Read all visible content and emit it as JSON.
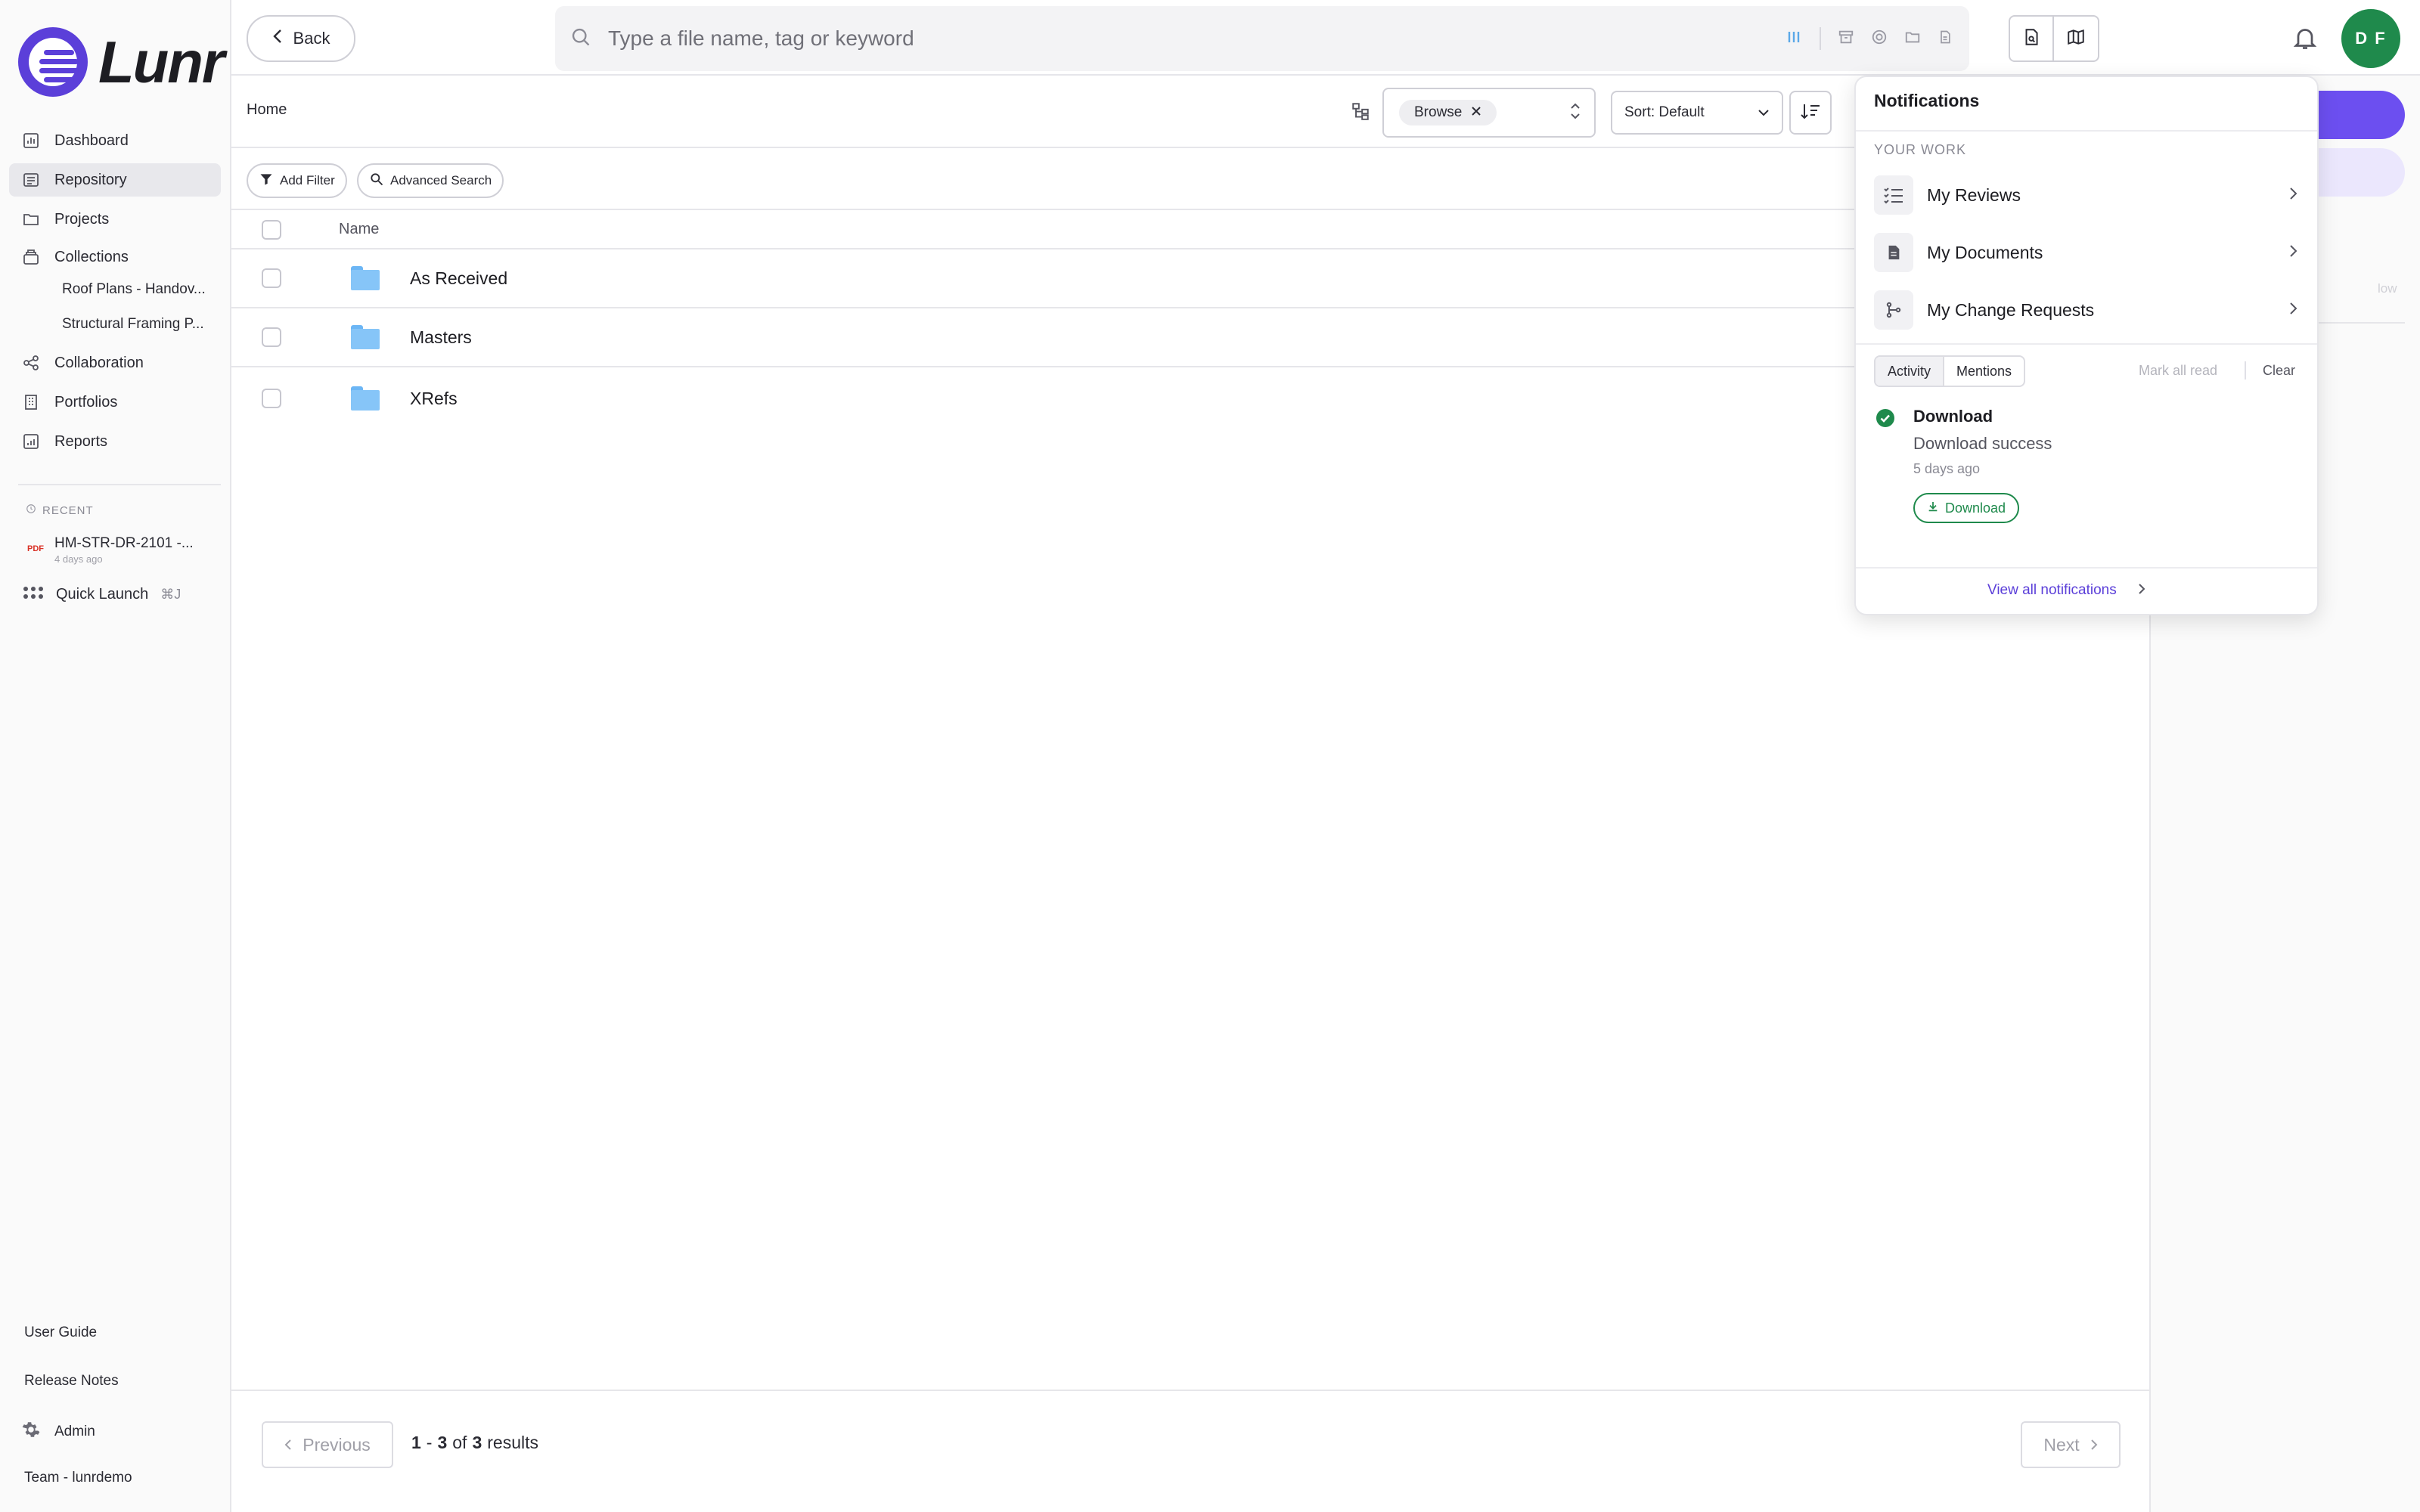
{
  "app": {
    "name": "Lunr"
  },
  "sidebar": {
    "items": [
      {
        "label": "Dashboard",
        "icon": "chart-icon"
      },
      {
        "label": "Repository",
        "icon": "repository-icon",
        "active": true
      },
      {
        "label": "Projects",
        "icon": "folder-icon"
      },
      {
        "label": "Collections",
        "icon": "collections-icon"
      },
      {
        "label": "Collaboration",
        "icon": "share-icon"
      },
      {
        "label": "Portfolios",
        "icon": "building-icon"
      },
      {
        "label": "Reports",
        "icon": "report-icon"
      }
    ],
    "collections": [
      "Roof Plans - Handov...",
      "Structural Framing P..."
    ],
    "recent_heading": "RECENT",
    "recent_item": {
      "badge": "PDF",
      "name": "HM-STR-DR-2101 -...",
      "time": "4 days ago"
    },
    "quick_launch": {
      "label": "Quick Launch",
      "shortcut": "⌘J"
    },
    "bottom": {
      "user_guide": "User Guide",
      "release_notes": "Release Notes",
      "admin": "Admin",
      "team": "Team - lunrdemo"
    }
  },
  "header": {
    "back_label": "Back",
    "search_placeholder": "Type a file name, tag or keyword",
    "avatar_initials": "D F"
  },
  "toolbar": {
    "breadcrumb": "Home",
    "browse_chip": "Browse",
    "sort_label": "Sort: Default",
    "add_filter": "Add Filter",
    "advanced_search": "Advanced Search"
  },
  "table": {
    "column_name": "Name",
    "rows": [
      {
        "name": "As Received"
      },
      {
        "name": "Masters"
      },
      {
        "name": "XRefs"
      }
    ]
  },
  "pagination": {
    "previous": "Previous",
    "next": "Next",
    "start": "1",
    "end": "3",
    "total": "3",
    "dash": "-",
    "of": "of",
    "results": "results"
  },
  "notifications": {
    "title": "Notifications",
    "section": "YOUR WORK",
    "links": [
      "My Reviews",
      "My Documents",
      "My Change Requests"
    ],
    "tab_activity": "Activity",
    "tab_mentions": "Mentions",
    "mark_all_read": "Mark all read",
    "clear": "Clear",
    "item": {
      "title": "Download",
      "body": "Download success",
      "time": "5 days ago",
      "action": "Download"
    },
    "view_all": "View all notifications"
  },
  "right_panel": {
    "faint_text": "low"
  },
  "colors": {
    "brand": "#5b3fd9",
    "success": "#1f8a4c",
    "avatar": "#1f8a4c",
    "folder": "#86c5f8",
    "link": "#5b3fd9"
  }
}
